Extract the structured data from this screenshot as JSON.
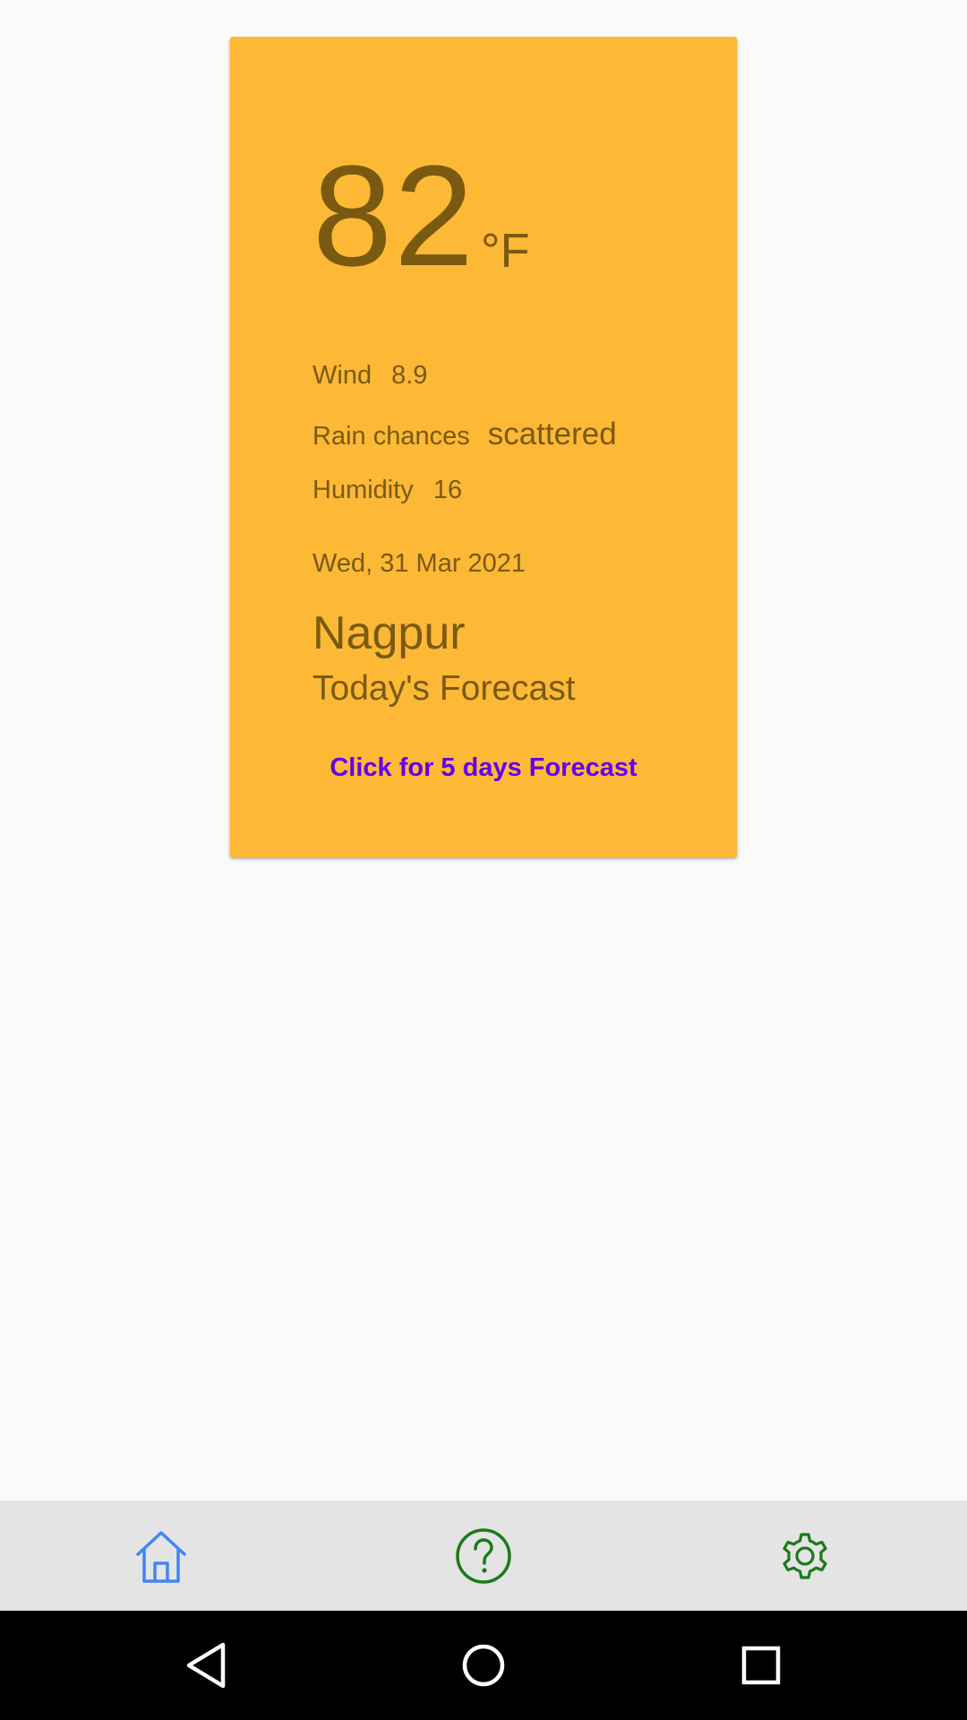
{
  "weather": {
    "temperature": "82",
    "unit": "°F",
    "wind_label": "Wind",
    "wind_value": "8.9",
    "rain_label": "Rain chances",
    "rain_value": "scattered",
    "humidity_label": "Humidity",
    "humidity_value": "16",
    "date": "Wed, 31 Mar 2021",
    "city": "Nagpur",
    "forecast_label": "Today's Forecast",
    "five_day_link": "Click for 5 days Forecast"
  },
  "bottom_nav": {
    "items": [
      {
        "icon": "home-icon",
        "color": "#4285f4"
      },
      {
        "icon": "help-icon",
        "color": "#1b7a1b"
      },
      {
        "icon": "settings-icon",
        "color": "#1b7a1b"
      }
    ]
  },
  "colors": {
    "card_background": "#fdb935",
    "card_text": "#7a5a10",
    "link": "#6200ee",
    "page_background": "#fafafa",
    "bottom_nav_background": "#e4e4e4",
    "system_nav_background": "#000000"
  },
  "system_nav": {
    "icons": [
      "back-icon",
      "home-circle-icon",
      "recents-icon"
    ]
  }
}
